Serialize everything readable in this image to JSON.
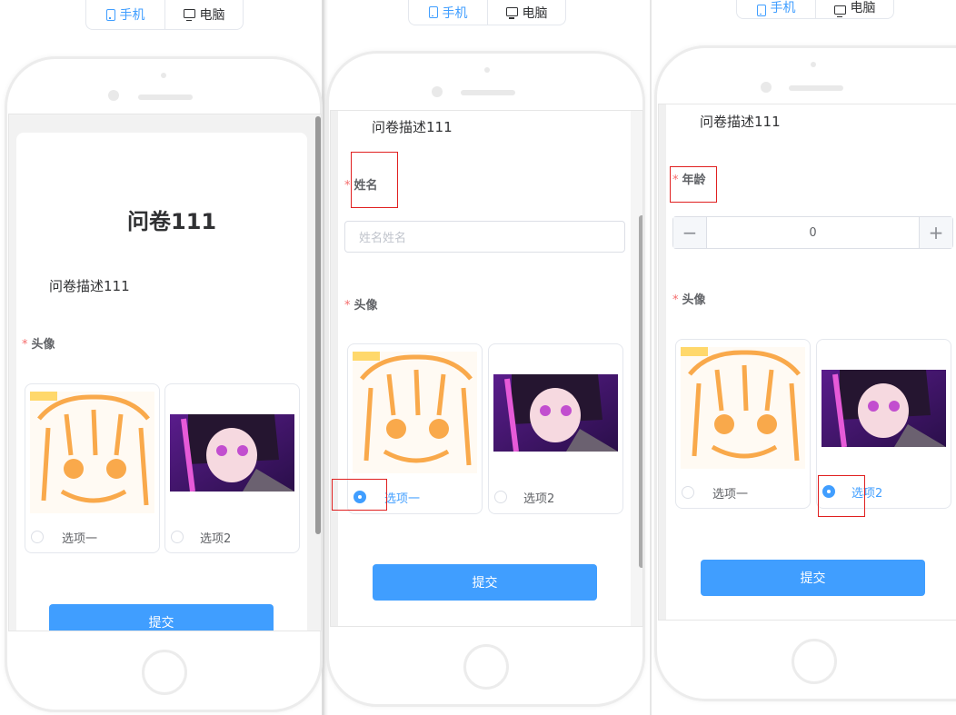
{
  "toggle": {
    "mobile_label": "手机",
    "desktop_label": "电脑"
  },
  "survey": {
    "title": "问卷111",
    "description": "问卷描述111",
    "required_mark": "*",
    "fields": {
      "name_label": "姓名",
      "name_placeholder": "姓名姓名",
      "age_label": "年龄",
      "age_value": "0",
      "avatar_label": "头像"
    },
    "options": {
      "option1": "选项一",
      "option2": "选项2"
    },
    "submit_label": "提交",
    "stepper": {
      "minus": "−",
      "plus": "+"
    }
  },
  "selection": {
    "panel1": "none",
    "panel2": "option1",
    "panel3": "option2"
  },
  "colors": {
    "primary": "#409eff",
    "required": "#f56c6c",
    "highlight": "#e02020"
  }
}
